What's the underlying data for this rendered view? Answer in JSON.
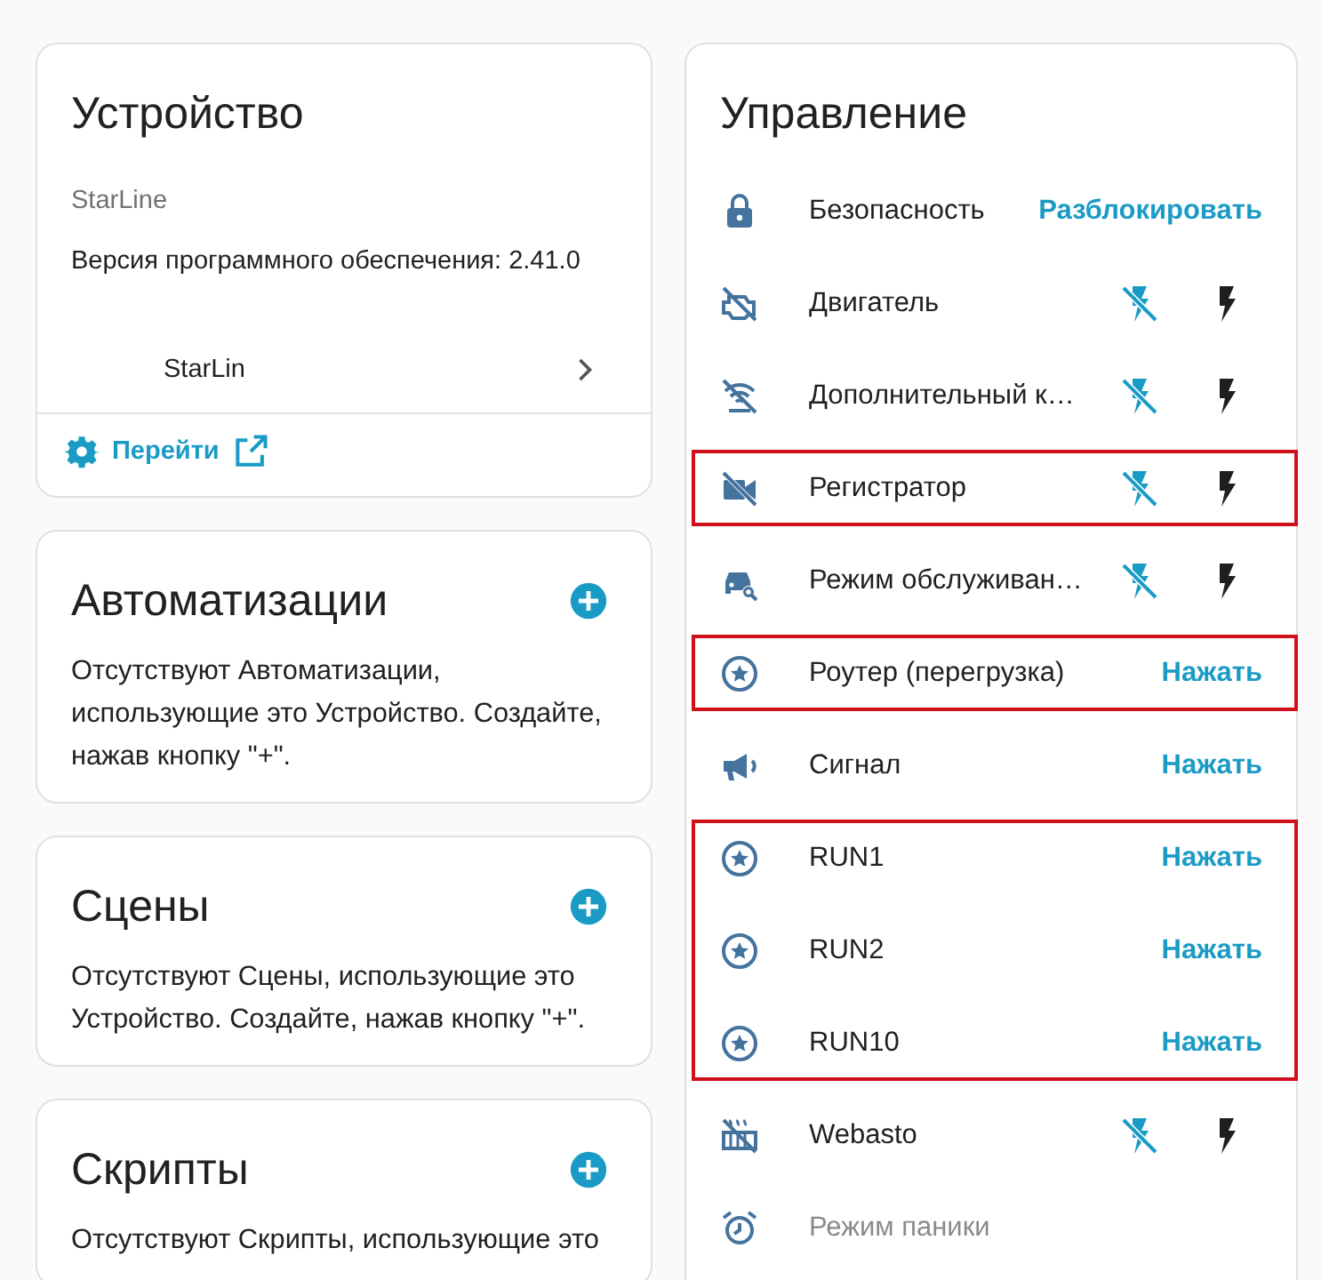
{
  "device_card": {
    "title": "Устройство",
    "manufacturer": "StarLine",
    "firmware": "Версия программного обеспечения: 2.41.0",
    "link": "StarLin",
    "action": "Перейти"
  },
  "related_cards": [
    {
      "title": "Автоматизации",
      "text": "Отсутствуют Автоматизации, использующие это Устройство. Создайте, нажав кнопку \"+\"."
    },
    {
      "title": "Сцены",
      "text": "Отсутствуют Сцены, использующие это Устройство. Создайте, нажав кнопку \"+\"."
    },
    {
      "title": "Скрипты",
      "text": "Отсутствуют Скрипты, использующие это"
    }
  ],
  "controls": {
    "title": "Управление",
    "rows": [
      {
        "name": "Безопасность",
        "kind": "button",
        "action": "Разблокировать",
        "highlighted": false,
        "disabled": false
      },
      {
        "name": "Двигатель",
        "kind": "toggle",
        "on": false,
        "highlighted": false,
        "disabled": false
      },
      {
        "name": "Дополнительный к…",
        "kind": "toggle",
        "on": false,
        "highlighted": false,
        "disabled": false
      },
      {
        "name": "Регистратор",
        "kind": "toggle",
        "on": false,
        "highlighted": true,
        "disabled": false
      },
      {
        "name": "Режим обслуживан…",
        "kind": "toggle",
        "on": false,
        "highlighted": false,
        "disabled": false
      },
      {
        "name": "Роутер (перегрузка)",
        "kind": "button",
        "action": "Нажать",
        "highlighted": true,
        "disabled": false
      },
      {
        "name": "Сигнал",
        "kind": "button",
        "action": "Нажать",
        "highlighted": false,
        "disabled": false
      },
      {
        "name": "RUN1",
        "kind": "button",
        "action": "Нажать",
        "highlighted": true,
        "disabled": false
      },
      {
        "name": "RUN2",
        "kind": "button",
        "action": "Нажать",
        "highlighted": true,
        "disabled": false
      },
      {
        "name": "RUN10",
        "kind": "button",
        "action": "Нажать",
        "highlighted": true,
        "disabled": false
      },
      {
        "name": "Webasto",
        "kind": "toggle",
        "on": false,
        "highlighted": false,
        "disabled": false
      },
      {
        "name": "Режим паники",
        "kind": "plain",
        "highlighted": false,
        "disabled": true
      }
    ]
  }
}
